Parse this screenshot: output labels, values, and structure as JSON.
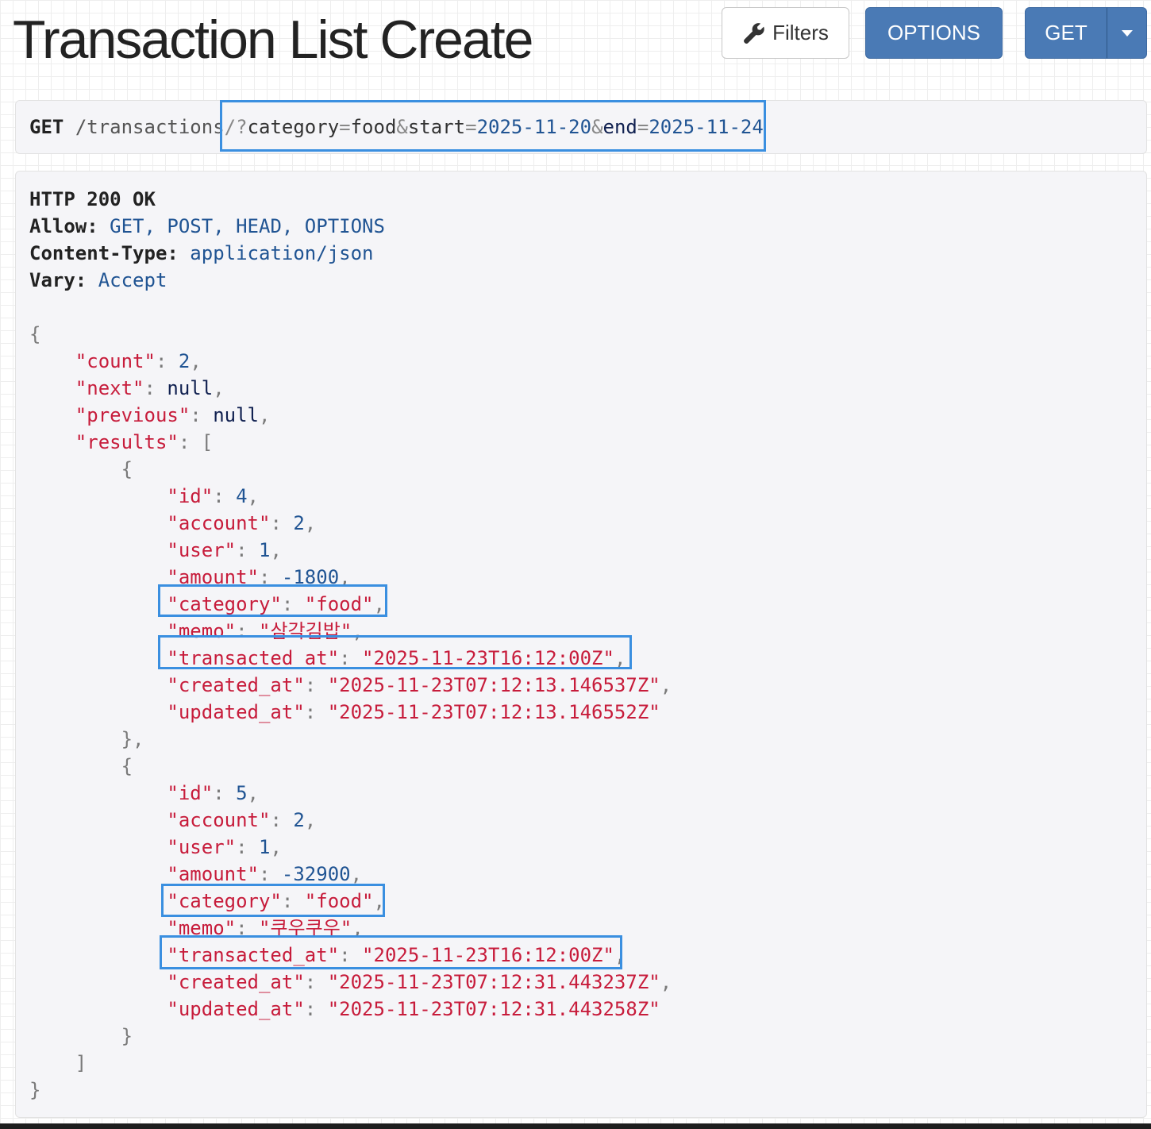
{
  "page": {
    "title": "Transaction List Create"
  },
  "toolbar": {
    "filters_label": "Filters",
    "filters_icon": "wrench-icon",
    "options_label": "OPTIONS",
    "get_label": "GET",
    "get_dropdown_icon": "caret-down-icon"
  },
  "request": {
    "method": "GET",
    "path": "/transactions",
    "query_prefix": "/?",
    "params": [
      {
        "name": "category",
        "value": "food"
      },
      {
        "name": "start",
        "value": "2025-11-20"
      },
      {
        "name": "end",
        "value": "2025-11-24"
      }
    ]
  },
  "response": {
    "status_line": "HTTP 200 OK",
    "headers": [
      {
        "name": "Allow:",
        "value": "GET, POST, HEAD, OPTIONS"
      },
      {
        "name": "Content-Type:",
        "value": "application/json"
      },
      {
        "name": "Vary:",
        "value": "Accept"
      }
    ],
    "body": {
      "count": "2",
      "next": "null",
      "previous": "null",
      "results": [
        {
          "id": "4",
          "account": "2",
          "user": "1",
          "amount": "-1800",
          "category": "food",
          "memo": "삼각김밥",
          "transacted_at": "2025-11-23T16:12:00Z",
          "created_at": "2025-11-23T07:12:13.146537Z",
          "updated_at": "2025-11-23T07:12:13.146552Z"
        },
        {
          "id": "5",
          "account": "2",
          "user": "1",
          "amount": "-32900",
          "category": "food",
          "memo": "쿠우쿠우",
          "transacted_at": "2025-11-23T16:12:00Z",
          "created_at": "2025-11-23T07:12:31.443237Z",
          "updated_at": "2025-11-23T07:12:31.443258Z"
        }
      ]
    }
  },
  "colors": {
    "primary_button": "#4a7ab5",
    "json_key": "#c71c3b",
    "json_number": "#205493",
    "highlight_box": "#3a8fe0"
  }
}
